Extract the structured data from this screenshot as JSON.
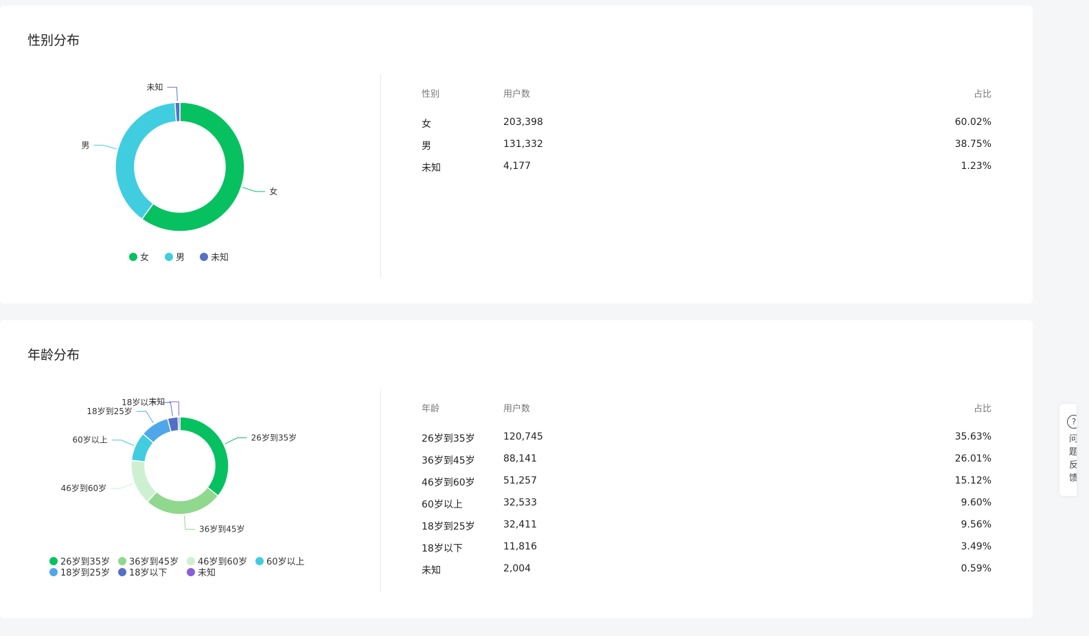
{
  "gender": {
    "title": "性别分布",
    "table": {
      "headers": [
        "性别",
        "用户数",
        "占比"
      ],
      "rows": [
        {
          "name": "女",
          "count": "203,398",
          "pct": "60.02%"
        },
        {
          "name": "男",
          "count": "131,332",
          "pct": "38.75%"
        },
        {
          "name": "未知",
          "count": "4,177",
          "pct": "1.23%"
        }
      ]
    }
  },
  "age": {
    "title": "年龄分布",
    "table": {
      "headers": [
        "年龄",
        "用户数",
        "占比"
      ],
      "rows": [
        {
          "name": "26岁到35岁",
          "count": "120,745",
          "pct": "35.63%"
        },
        {
          "name": "36岁到45岁",
          "count": "88,141",
          "pct": "26.01%"
        },
        {
          "name": "46岁到60岁",
          "count": "51,257",
          "pct": "15.12%"
        },
        {
          "name": "60岁以上",
          "count": "32,533",
          "pct": "9.60%"
        },
        {
          "name": "18岁到25岁",
          "count": "32,411",
          "pct": "9.56%"
        },
        {
          "name": "18岁以下",
          "count": "11,816",
          "pct": "3.49%"
        },
        {
          "name": "未知",
          "count": "2,004",
          "pct": "0.59%"
        }
      ]
    }
  },
  "chart_data": [
    {
      "type": "pie",
      "title": "性别分布",
      "categories": [
        "女",
        "男",
        "未知"
      ],
      "values": [
        203398,
        131332,
        4177
      ],
      "colors": [
        "#07c160",
        "#40cde0",
        "#5470c6"
      ],
      "legend": "bottom",
      "donut": true
    },
    {
      "type": "pie",
      "title": "年龄分布",
      "categories": [
        "26岁到35岁",
        "36岁到45岁",
        "46岁到60岁",
        "60岁以上",
        "18岁到25岁",
        "18岁以下",
        "未知"
      ],
      "values": [
        120745,
        88141,
        51257,
        32533,
        32411,
        11816,
        2004
      ],
      "colors": [
        "#07c160",
        "#8fd88e",
        "#cdf0d2",
        "#40cde0",
        "#4ea7ea",
        "#5470c6",
        "#8a5fd6"
      ],
      "legend": "bottom",
      "donut": true
    }
  ],
  "feedback": {
    "icon": "question-icon",
    "label": "问题反馈"
  }
}
